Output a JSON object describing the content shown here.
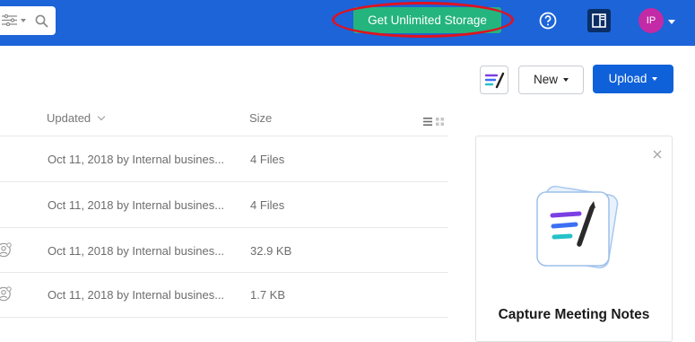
{
  "topbar": {
    "search_icons": [
      "filter-icon",
      "chevron-down-icon",
      "search-icon"
    ],
    "cta_label": "Get Unlimited Storage",
    "help_icon": "help-circle-icon",
    "panel_icon": "side-panel-icon",
    "avatar_initials": "IP"
  },
  "toolbar": {
    "notes_icon": "box-notes-icon",
    "new_label": "New",
    "upload_label": "Upload"
  },
  "table": {
    "headers": {
      "updated": "Updated",
      "size": "Size"
    },
    "rows": [
      {
        "updated": "Oct 11, 2018 by Internal busines...",
        "size": "4 Files",
        "shared": false
      },
      {
        "updated": "Oct 11, 2018 by Internal busines...",
        "size": "4 Files",
        "shared": false
      },
      {
        "updated": "Oct 11, 2018 by Internal busines...",
        "size": "32.9 KB",
        "shared": true
      },
      {
        "updated": "Oct 11, 2018 by Internal busines...",
        "size": "1.7 KB",
        "shared": true
      }
    ]
  },
  "promo": {
    "title": "Capture Meeting Notes"
  },
  "colors": {
    "topbar": "#1c64d8",
    "cta": "#24b47e",
    "highlight_oval": "#e0121f",
    "avatar": "#c32aa5",
    "upload": "#0f61d9"
  }
}
